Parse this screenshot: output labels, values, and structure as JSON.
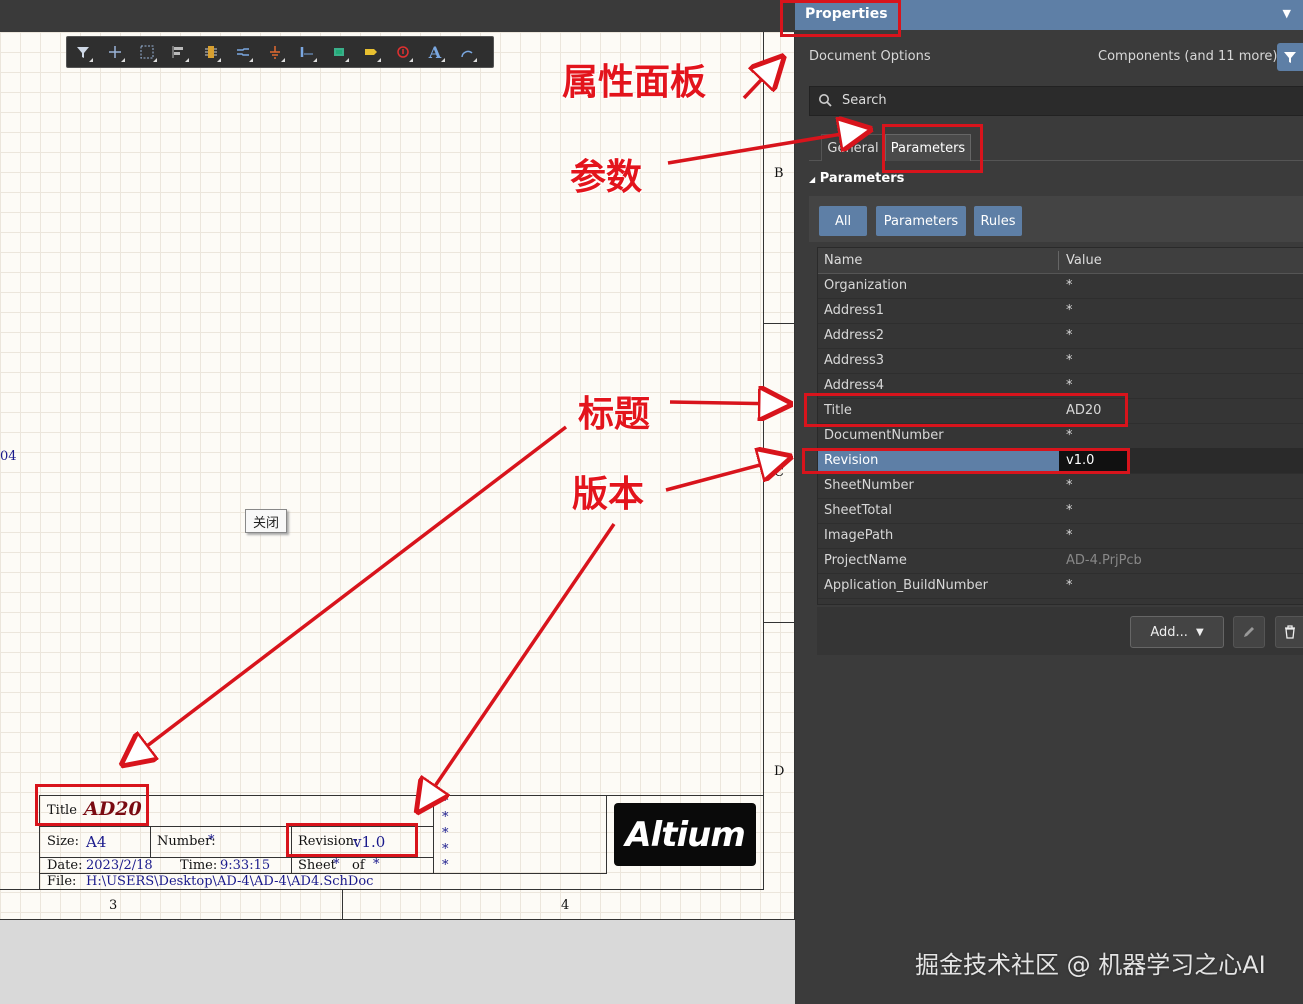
{
  "toolbar_icons": [
    "filter-icon",
    "cross-icon",
    "select-rect-icon",
    "align-icon",
    "part-icon",
    "wire-icon",
    "power-icon",
    "bus-icon",
    "harness-icon",
    "port-icon",
    "directive-icon",
    "text-icon",
    "arc-icon"
  ],
  "sheet": {
    "zone_b": "B",
    "zone_c": "C",
    "zone_d": "D",
    "col_3": "3",
    "col_4": "4",
    "left_fragment": "04",
    "close_tooltip": "关闭",
    "title_block": {
      "title_label": "Title",
      "title_value": "AD20",
      "size_label": "Size:",
      "size_value": "A4",
      "number_label": "Number:",
      "number_value": "*",
      "revision_label": "Revision:",
      "revision_value": "v1.0",
      "date_label": "Date:",
      "date_value": "2023/2/18",
      "time_label": "Time:",
      "time_value": "9:33:15",
      "sheet_label": "Sheet",
      "sheet_value": "*",
      "of_label": "of",
      "of_value": "*",
      "file_label": "File:",
      "file_value": "H:\\USERS\\Desktop\\AD-4\\AD-4\\AD4.SchDoc",
      "stars": [
        "*",
        "*",
        "*",
        "*",
        "*"
      ],
      "logo": "Altium"
    }
  },
  "panel": {
    "title": "Properties",
    "menu_icon": "dropdown-icon",
    "doc_options": "Document Options",
    "components": "Components (and 11 more)",
    "search_placeholder": "Search",
    "tabs": [
      "General",
      "Parameters"
    ],
    "section": "Parameters",
    "filters": [
      "All",
      "Parameters",
      "Rules"
    ],
    "columns": [
      "Name",
      "Value"
    ],
    "rows": [
      {
        "name": "Organization",
        "value": "*"
      },
      {
        "name": "Address1",
        "value": "*"
      },
      {
        "name": "Address2",
        "value": "*"
      },
      {
        "name": "Address3",
        "value": "*"
      },
      {
        "name": "Address4",
        "value": "*"
      },
      {
        "name": "Title",
        "value": "AD20"
      },
      {
        "name": "DocumentNumber",
        "value": "*"
      },
      {
        "name": "Revision",
        "value": "v1.0"
      },
      {
        "name": "SheetNumber",
        "value": "*"
      },
      {
        "name": "SheetTotal",
        "value": "*"
      },
      {
        "name": "ImagePath",
        "value": "*"
      },
      {
        "name": "ProjectName",
        "value": "AD-4.PrjPcb"
      },
      {
        "name": "Application_BuildNumber",
        "value": "*"
      }
    ],
    "add_button": "Add...",
    "watermark": "掘金技术社区 @ 机器学习之心AI"
  },
  "annotations": {
    "properties_panel": "属性面板",
    "parameters": "参数",
    "title": "标题",
    "revision": "版本"
  },
  "colors": {
    "accent": "#5e7fa6",
    "annotation": "#d8141c",
    "panel_bg": "#3b3b3b",
    "sheet_bg": "#fdfbf6"
  }
}
